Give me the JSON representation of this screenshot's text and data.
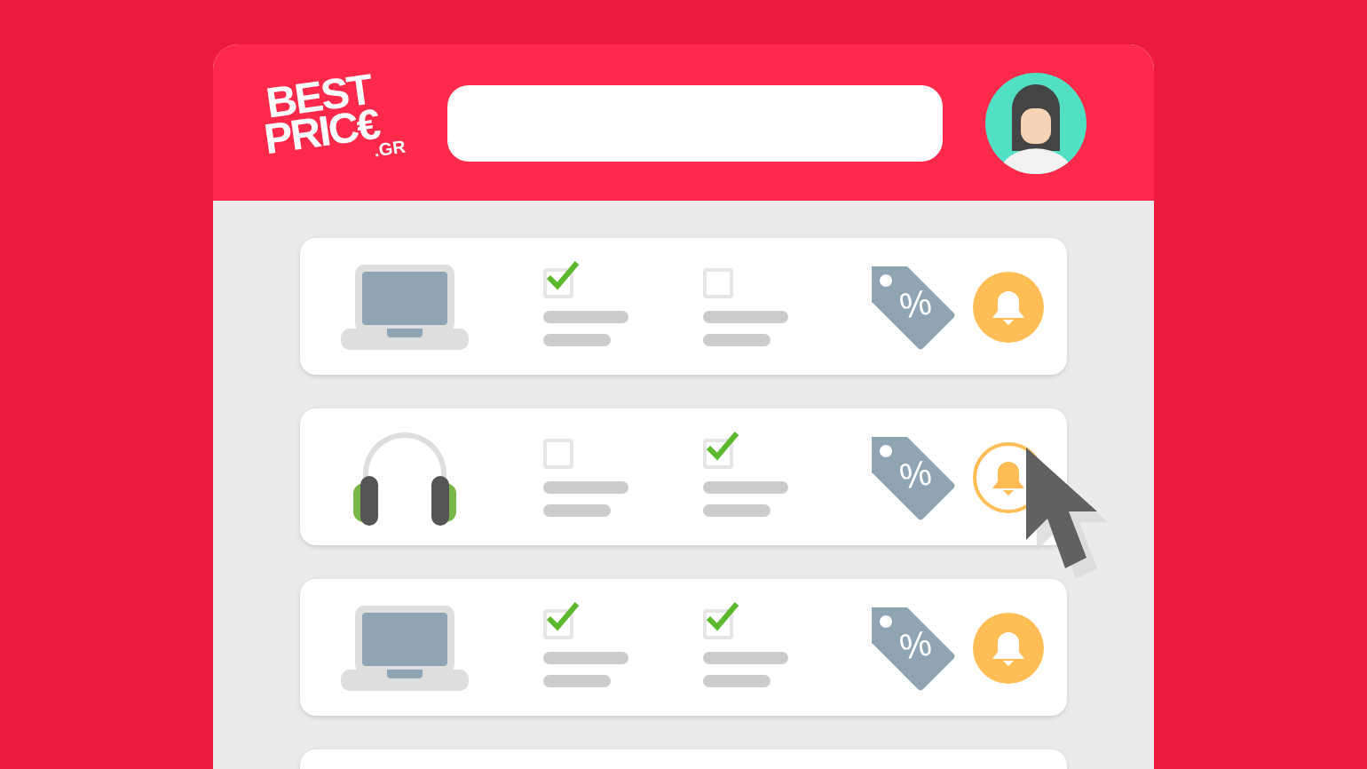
{
  "logo": {
    "line_1": "BEST",
    "line_2": "PRIC€",
    "suffix": ".GR"
  },
  "products": [
    {
      "kind": "laptop",
      "checks": [
        {
          "checked": true
        },
        {
          "checked": false
        }
      ],
      "tag_symbol": "%",
      "alert_highlighted": false
    },
    {
      "kind": "headphones",
      "checks": [
        {
          "checked": false
        },
        {
          "checked": true
        }
      ],
      "tag_symbol": "%",
      "alert_highlighted": true
    },
    {
      "kind": "laptop",
      "checks": [
        {
          "checked": true
        },
        {
          "checked": true
        }
      ],
      "tag_symbol": "%",
      "alert_highlighted": false
    },
    {
      "kind": "empty"
    }
  ]
}
